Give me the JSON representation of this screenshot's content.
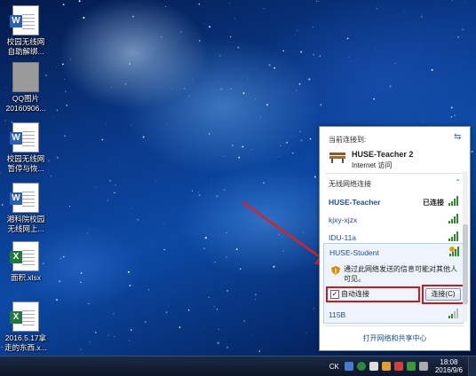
{
  "desktop": {
    "icons": [
      {
        "line1": "校园无线网",
        "line2": "自助解绑...",
        "icon": "word-doc-icon"
      },
      {
        "line1": "QQ图片",
        "line2": "20160906...",
        "icon": "image-file-icon"
      },
      {
        "line1": "校园无线网",
        "line2": "暂停与恢...",
        "icon": "word-doc-icon"
      },
      {
        "line1": "湘科院校园",
        "line2": "无线网上...",
        "icon": "word-doc-icon"
      },
      {
        "line1": "面积.xlsx",
        "line2": "",
        "icon": "excel-file-icon"
      },
      {
        "line1": "2016.5.17拿",
        "line2": "走的东西.x...",
        "icon": "excel-file-icon"
      }
    ]
  },
  "popup": {
    "current_label": "当前连接到:",
    "current_network": "HUSE-Teacher  2",
    "current_status": "Internet 访问",
    "group_label": "无线网络连接",
    "networks": [
      {
        "name": "HUSE-Teacher",
        "status": "已连接",
        "bold": true
      },
      {
        "name": "kjxy-xjzx",
        "status": ""
      },
      {
        "name": "IDU-11a",
        "status": ""
      },
      {
        "name": "HUSE-Student",
        "status": ""
      },
      {
        "name": "115B",
        "status": ""
      }
    ],
    "warning": "通过此网络发送的信息可能对其他人可见。",
    "auto_connect_label": "自动连接",
    "auto_connect_checked": "✓",
    "connect_button": "连接(C)",
    "footer_link": "打开网络和共享中心"
  },
  "taskbar": {
    "lang": "CK",
    "time": "18:08",
    "date": "2016/9/6"
  },
  "colors": {
    "highlight_red": "#d01919",
    "link_blue": "#1e4fa0"
  }
}
